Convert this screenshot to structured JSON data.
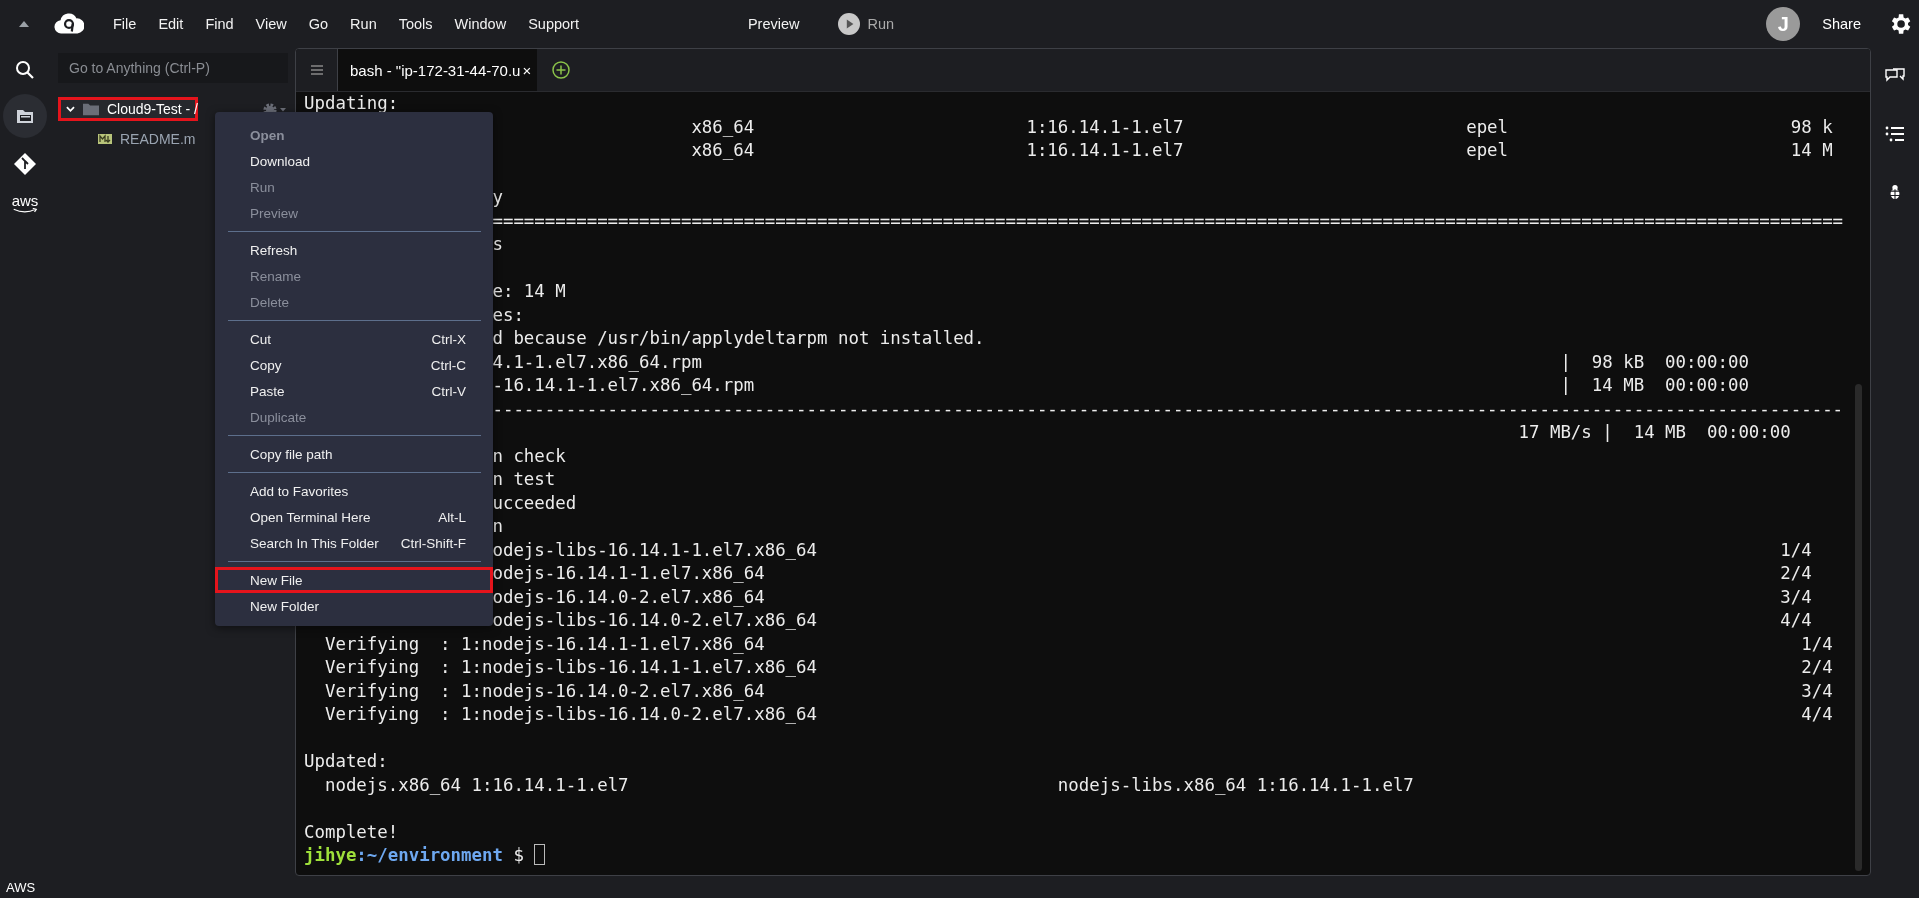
{
  "top_bar": {
    "menu": [
      {
        "label": "File"
      },
      {
        "label": "Edit"
      },
      {
        "label": "Find"
      },
      {
        "label": "View"
      },
      {
        "label": "Go"
      },
      {
        "label": "Run"
      },
      {
        "label": "Tools"
      },
      {
        "label": "Window"
      },
      {
        "label": "Support"
      }
    ],
    "preview": "Preview",
    "run": "Run",
    "avatar": "J",
    "share": "Share"
  },
  "left_rail": {
    "aws_label": "aws",
    "files_selected": true
  },
  "sidebar": {
    "search_placeholder": "Go to Anything (Ctrl-P)",
    "tree": [
      {
        "label": "Cloud9-Test - /",
        "expanded": true,
        "annotated": true,
        "children": [
          {
            "label": "README.m",
            "annotated": false
          }
        ]
      }
    ]
  },
  "context_menu": {
    "groups": [
      [
        {
          "label": "Open",
          "disabled": true,
          "default": true,
          "annotated": false
        },
        {
          "label": "Download",
          "disabled": false,
          "default": false,
          "annotated": false
        },
        {
          "label": "Run",
          "disabled": true,
          "default": false,
          "annotated": false
        },
        {
          "label": "Preview",
          "disabled": true,
          "default": false,
          "annotated": false
        }
      ],
      [
        {
          "label": "Refresh",
          "disabled": false,
          "default": false,
          "annotated": false
        },
        {
          "label": "Rename",
          "disabled": true,
          "default": false,
          "annotated": false
        },
        {
          "label": "Delete",
          "disabled": true,
          "default": false,
          "annotated": false
        }
      ],
      [
        {
          "label": "Cut",
          "shortcut": "Ctrl-X",
          "disabled": false,
          "default": false,
          "annotated": false
        },
        {
          "label": "Copy",
          "shortcut": "Ctrl-C",
          "disabled": false,
          "default": false,
          "annotated": false
        },
        {
          "label": "Paste",
          "shortcut": "Ctrl-V",
          "disabled": false,
          "default": false,
          "annotated": false
        },
        {
          "label": "Duplicate",
          "disabled": true,
          "default": false,
          "annotated": false
        }
      ],
      [
        {
          "label": "Copy file path",
          "disabled": false,
          "default": false,
          "annotated": false
        }
      ],
      [
        {
          "label": "Add to Favorites",
          "disabled": false,
          "default": false,
          "annotated": false
        },
        {
          "label": "Open Terminal Here",
          "shortcut": "Alt-L",
          "disabled": false,
          "default": false,
          "annotated": false
        },
        {
          "label": "Search In This Folder",
          "shortcut": "Ctrl-Shift-F",
          "disabled": false,
          "default": false,
          "annotated": false
        }
      ],
      [
        {
          "label": "New File",
          "disabled": false,
          "default": false,
          "annotated": true
        },
        {
          "label": "New Folder",
          "disabled": false,
          "default": false,
          "annotated": false
        }
      ]
    ]
  },
  "terminal": {
    "tab": {
      "label": "bash - \"ip-172-31-44-70.u",
      "close": "×",
      "selected": true
    },
    "lines": [
      {
        "kind": "text",
        "covered": false,
        "text": "Updating:"
      },
      {
        "kind": "text",
        "covered": true,
        "text": "                   x86_64                          1:16.14.1-1.el7                           epel                           98 k"
      },
      {
        "kind": "text",
        "covered": true,
        "text": "                   x86_64                          1:16.14.1-1.el7                           epel                           14 M"
      },
      {
        "kind": "blank"
      },
      {
        "kind": "text",
        "covered": true,
        "text": "y"
      },
      {
        "kind": "text",
        "covered": true,
        "text": "================================================================================================================================="
      },
      {
        "kind": "text",
        "covered": true,
        "text": "s"
      },
      {
        "kind": "blank"
      },
      {
        "kind": "text",
        "covered": true,
        "text": "e: 14 M"
      },
      {
        "kind": "text",
        "covered": true,
        "text": "es:"
      },
      {
        "kind": "text",
        "covered": true,
        "text": "d because /usr/bin/applydeltarpm not installed."
      },
      {
        "kind": "text",
        "covered": true,
        "text": "4.1-1.el7.x86_64.rpm                                                                                  |  98 kB  00:00:00"
      },
      {
        "kind": "text",
        "covered": true,
        "text": "-16.14.1-1.el7.x86_64.rpm                                                                             |  14 MB  00:00:00"
      },
      {
        "kind": "text",
        "covered": true,
        "text": "---------------------------------------------------------------------------------------------------------------------------------"
      },
      {
        "kind": "text",
        "covered": true,
        "text": "                                                                                                  17 MB/s |  14 MB  00:00:00"
      },
      {
        "kind": "text",
        "covered": true,
        "text": "n check"
      },
      {
        "kind": "text",
        "covered": true,
        "text": "n test"
      },
      {
        "kind": "text",
        "covered": true,
        "text": "ucceeded"
      },
      {
        "kind": "text",
        "covered": true,
        "text": "n"
      },
      {
        "kind": "text",
        "covered": true,
        "text": "odejs-libs-16.14.1-1.el7.x86_64                                                                                            1/4"
      },
      {
        "kind": "text",
        "covered": true,
        "text": "odejs-16.14.1-1.el7.x86_64                                                                                                 2/4"
      },
      {
        "kind": "text",
        "covered": true,
        "text": "odejs-16.14.0-2.el7.x86_64                                                                                                 3/4"
      },
      {
        "kind": "text",
        "covered": true,
        "text": "odejs-libs-16.14.0-2.el7.x86_64                                                                                            4/4"
      },
      {
        "kind": "text",
        "covered": false,
        "text": "  Verifying  : 1:nodejs-16.14.1-1.el7.x86_64                                                                                                   1/4"
      },
      {
        "kind": "text",
        "covered": false,
        "text": "  Verifying  : 1:nodejs-libs-16.14.1-1.el7.x86_64                                                                                              2/4"
      },
      {
        "kind": "text",
        "covered": false,
        "text": "  Verifying  : 1:nodejs-16.14.0-2.el7.x86_64                                                                                                   3/4"
      },
      {
        "kind": "text",
        "covered": false,
        "text": "  Verifying  : 1:nodejs-libs-16.14.0-2.el7.x86_64                                                                                              4/4"
      },
      {
        "kind": "blank"
      },
      {
        "kind": "text",
        "covered": false,
        "text": "Updated:"
      },
      {
        "kind": "text",
        "covered": false,
        "text": "  nodejs.x86_64 1:16.14.1-1.el7                                         nodejs-libs.x86_64 1:16.14.1-1.el7"
      },
      {
        "kind": "blank"
      },
      {
        "kind": "text",
        "covered": false,
        "text": "Complete!"
      },
      {
        "kind": "prompt",
        "user": "jihye",
        "path": ":~/environment",
        "symbol": "$"
      }
    ]
  },
  "status_bar": {
    "label": "AWS"
  }
}
